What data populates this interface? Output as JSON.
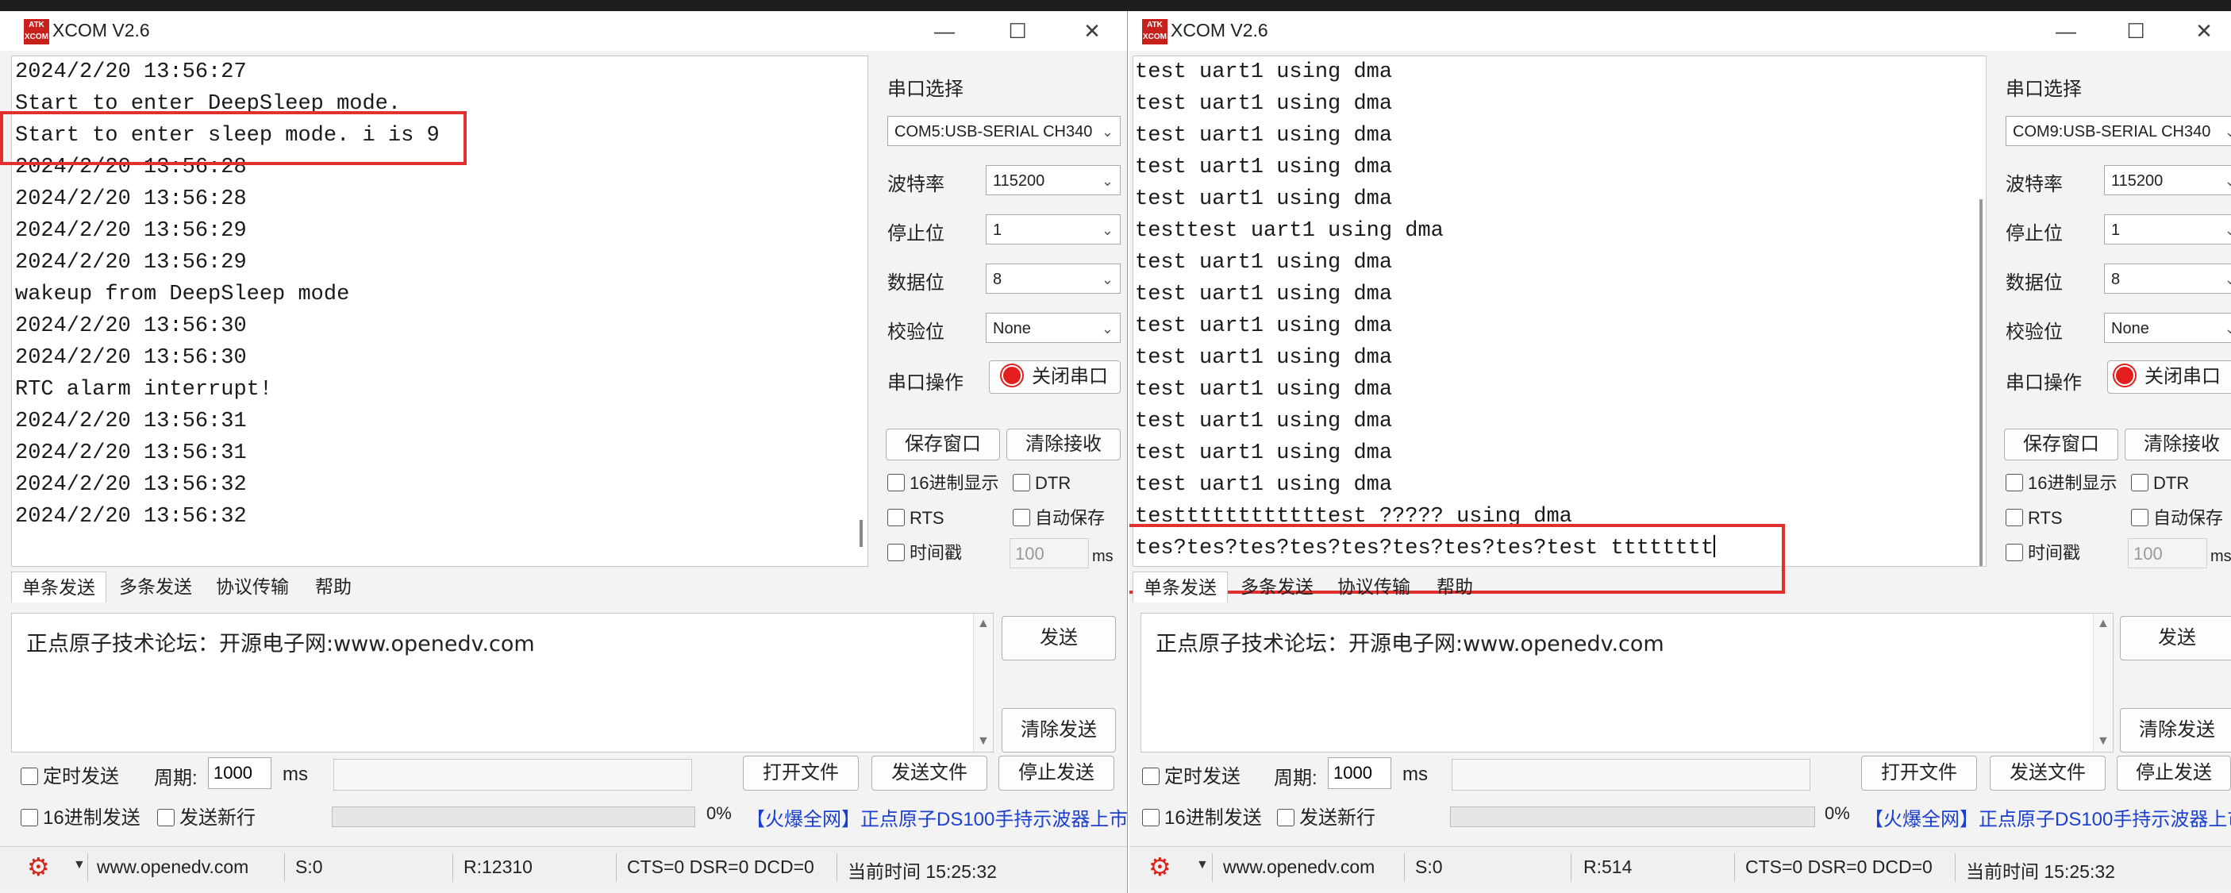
{
  "window1": {
    "title": "XCOM V2.6",
    "logo": "ATK XCOM",
    "receive_lines": [
      "2024/2/20 13:56:27",
      "Start to enter DeepSleep mode.",
      "Start to enter sleep mode. i is 9",
      "2024/2/20 13:56:28",
      "2024/2/20 13:56:28",
      "2024/2/20 13:56:29",
      "2024/2/20 13:56:29",
      "wakeup from DeepSleep mode",
      "2024/2/20 13:56:30",
      "2024/2/20 13:56:30",
      "RTC alarm interrupt!",
      "2024/2/20 13:56:31",
      "2024/2/20 13:56:31",
      "2024/2/20 13:56:32",
      "2024/2/20 13:56:32"
    ],
    "port_label": "串口选择",
    "port_value": "COM5:USB-SERIAL CH340",
    "baud_label": "波特率",
    "baud_value": "115200",
    "stop_label": "停止位",
    "stop_value": "1",
    "data_label": "数据位",
    "data_value": "8",
    "parity_label": "校验位",
    "parity_value": "None",
    "op_label": "串口操作",
    "close_port": "关闭串口",
    "save_window": "保存窗口",
    "clear_receive": "清除接收",
    "hex_display": "16进制显示",
    "dtr": "DTR",
    "rts": "RTS",
    "auto_save": "自动保存",
    "timestamp": "时间戳",
    "timestamp_ms_value": "100",
    "ms": "ms",
    "tabs": [
      "单条发送",
      "多条发送",
      "协议传输",
      "帮助"
    ],
    "send_text": "正点原子技术论坛：开源电子网:www.openedv.com",
    "send_button": "发送",
    "clear_send": "清除发送",
    "timed_send": "定时发送",
    "period_label": "周期:",
    "period_value": "1000",
    "open_file": "打开文件",
    "send_file": "发送文件",
    "stop_send": "停止发送",
    "hex_send": "16进制发送",
    "send_newline": "发送新行",
    "progress": "0%",
    "ad_text": "【火爆全网】正点原子DS100手持示波器上市",
    "status": {
      "url": "www.openedv.com",
      "s": "S:0",
      "r": "R:12310",
      "lines": "CTS=0 DSR=0 DCD=0",
      "time": "当前时间 15:25:32"
    }
  },
  "window2": {
    "title": "XCOM V2.6",
    "logo": "ATK XCOM",
    "receive_lines": [
      "test uart1 using dma",
      "test uart1 using dma",
      "test uart1 using dma",
      "test uart1 using dma",
      "test uart1 using dma",
      "testtest uart1 using dma",
      "test uart1 using dma",
      "test uart1 using dma",
      "test uart1 using dma",
      "test uart1 using dma",
      "test uart1 using dma",
      "test uart1 using dma",
      "test uart1 using dma",
      "test uart1 using dma",
      "testtttttttttttest ????? using dma",
      "tes?tes?tes?tes?tes?tes?tes?tes?test tttttttt"
    ],
    "port_label": "串口选择",
    "port_value": "COM9:USB-SERIAL CH340",
    "baud_label": "波特率",
    "baud_value": "115200",
    "stop_label": "停止位",
    "stop_value": "1",
    "data_label": "数据位",
    "data_value": "8",
    "parity_label": "校验位",
    "parity_value": "None",
    "op_label": "串口操作",
    "close_port": "关闭串口",
    "save_window": "保存窗口",
    "clear_receive": "清除接收",
    "hex_display": "16进制显示",
    "dtr": "DTR",
    "rts": "RTS",
    "auto_save": "自动保存",
    "timestamp": "时间戳",
    "timestamp_ms_value": "100",
    "ms": "ms",
    "tabs": [
      "单条发送",
      "多条发送",
      "协议传输",
      "帮助"
    ],
    "send_text": "正点原子技术论坛：开源电子网:www.openedv.com",
    "send_button": "发送",
    "clear_send": "清除发送",
    "timed_send": "定时发送",
    "period_label": "周期:",
    "period_value": "1000",
    "open_file": "打开文件",
    "send_file": "发送文件",
    "stop_send": "停止发送",
    "hex_send": "16进制发送",
    "send_newline": "发送新行",
    "progress": "0%",
    "ad_text": "【火爆全网】正点原子DS100手持示波器上市",
    "status": {
      "url": "www.openedv.com",
      "s": "S:0",
      "r": "R:514",
      "lines": "CTS=0 DSR=0 DCD=0",
      "time": "当前时间 15:25:32"
    }
  },
  "icons": {
    "minimize": "minimize-icon",
    "maximize": "maximize-icon",
    "close": "close-icon",
    "gear": "gear-icon"
  },
  "colors": {
    "highlight_box": "#e23030",
    "ad_link": "#1a3fd1",
    "led": "#e41d1d"
  }
}
